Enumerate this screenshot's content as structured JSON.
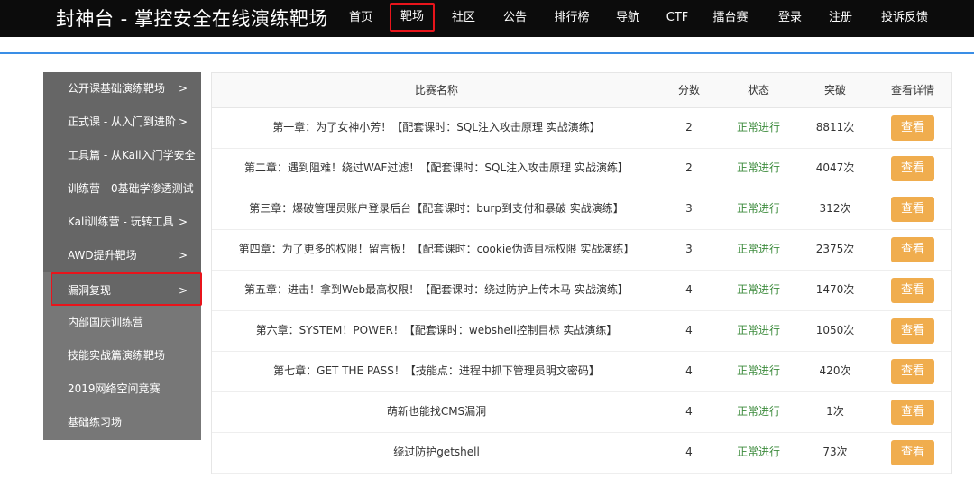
{
  "header": {
    "title": "封神台 - 掌控安全在线演练靶场",
    "nav": [
      "首页",
      "靶场",
      "社区",
      "公告",
      "排行榜",
      "导航",
      "CTF",
      "擂台赛",
      "登录",
      "注册",
      "投诉反馈"
    ],
    "highlight_color": "#e8141b",
    "accent_color": "#3a8ee6"
  },
  "sidebar": {
    "items": [
      {
        "label": "公开课基础演练靶场",
        "arrow": ">"
      },
      {
        "label": "正式课 - 从入门到进阶",
        "arrow": ">"
      },
      {
        "label": "工具篇 - 从Kali入门学安全",
        "arrow": ""
      },
      {
        "label": "训练营 - 0基础学渗透测试",
        "arrow": ""
      },
      {
        "label": "Kali训练营 - 玩转工具",
        "arrow": ">"
      },
      {
        "label": "AWD提升靶场",
        "arrow": ">"
      },
      {
        "label": "漏洞复现",
        "arrow": ">"
      },
      {
        "label": "内部国庆训练营",
        "arrow": ""
      },
      {
        "label": "技能实战篇演练靶场",
        "arrow": ""
      },
      {
        "label": "2019网络空间竞赛",
        "arrow": ""
      },
      {
        "label": "基础练习场",
        "arrow": ""
      }
    ]
  },
  "table": {
    "headers": [
      "比赛名称",
      "分数",
      "状态",
      "突破",
      "查看详情"
    ],
    "rows": [
      {
        "name": "第一章：为了女神小芳！【配套课时：SQL注入攻击原理 实战演练】",
        "score": "2",
        "status": "正常进行",
        "count": "8811次",
        "button": "查看"
      },
      {
        "name": "第二章：遇到阻难！绕过WAF过滤！【配套课时：SQL注入攻击原理 实战演练】",
        "score": "2",
        "status": "正常进行",
        "count": "4047次",
        "button": "查看"
      },
      {
        "name": "第三章：爆破管理员账户登录后台【配套课时：burp到支付和暴破 实战演练】",
        "score": "3",
        "status": "正常进行",
        "count": "312次",
        "button": "查看"
      },
      {
        "name": "第四章：为了更多的权限！留言板！【配套课时：cookie伪造目标权限 实战演练】",
        "score": "3",
        "status": "正常进行",
        "count": "2375次",
        "button": "查看"
      },
      {
        "name": "第五章：进击！拿到Web最高权限！【配套课时：绕过防护上传木马 实战演练】",
        "score": "4",
        "status": "正常进行",
        "count": "1470次",
        "button": "查看"
      },
      {
        "name": "第六章：SYSTEM！POWER！【配套课时：webshell控制目标 实战演练】",
        "score": "4",
        "status": "正常进行",
        "count": "1050次",
        "button": "查看"
      },
      {
        "name": "第七章：GET THE PASS！【技能点：进程中抓下管理员明文密码】",
        "score": "4",
        "status": "正常进行",
        "count": "420次",
        "button": "查看"
      },
      {
        "name": "萌新也能找CMS漏洞",
        "score": "4",
        "status": "正常进行",
        "count": "1次",
        "button": "查看"
      },
      {
        "name": "绕过防护getshell",
        "score": "4",
        "status": "正常进行",
        "count": "73次",
        "button": "查看"
      }
    ]
  }
}
